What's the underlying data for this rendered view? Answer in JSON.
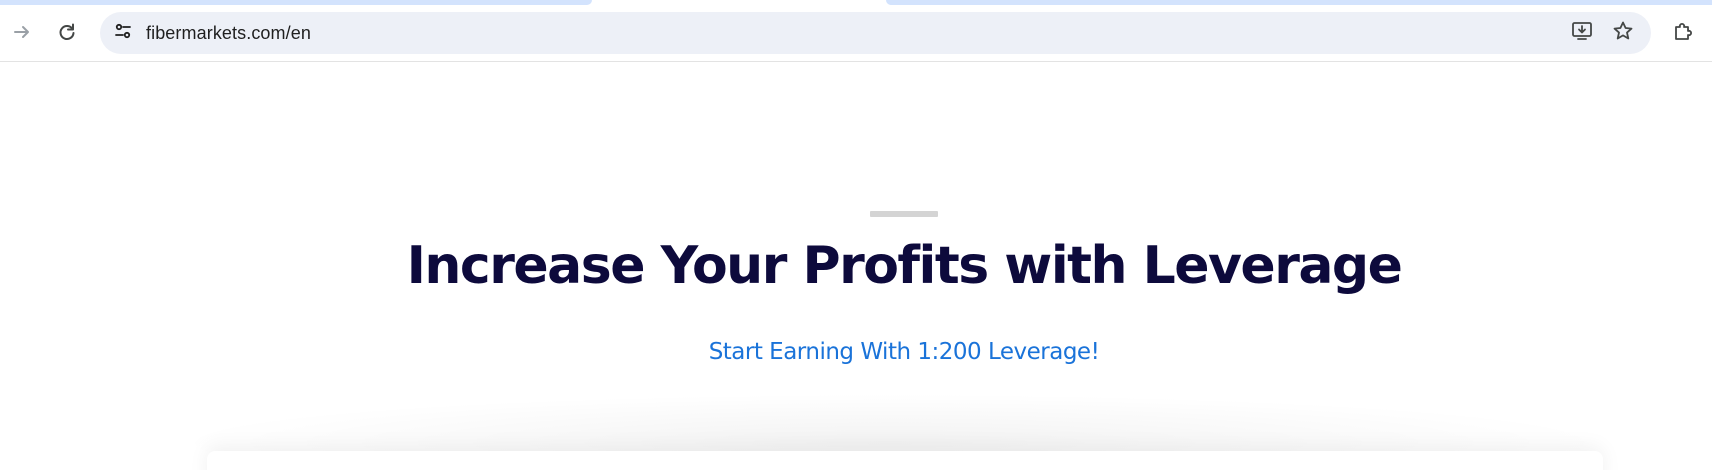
{
  "browser": {
    "address_bar": {
      "url": "fibermarkets.com/en"
    },
    "icons": {
      "forward": "arrow-right-icon",
      "reload": "reload-icon",
      "site_info": "tune-icon",
      "install": "install-app-icon",
      "bookmark": "star-icon",
      "extensions": "puzzle-icon"
    },
    "colors": {
      "tab_accent": "#d3e3fd",
      "omnibox_bg": "#edf0f7"
    }
  },
  "hero": {
    "title": "Increase Your Profits with Leverage",
    "subtitle": "Start Earning With 1:200 Leverage!",
    "colors": {
      "title": "#0d0a3c",
      "subtitle": "#1a73d9"
    }
  }
}
